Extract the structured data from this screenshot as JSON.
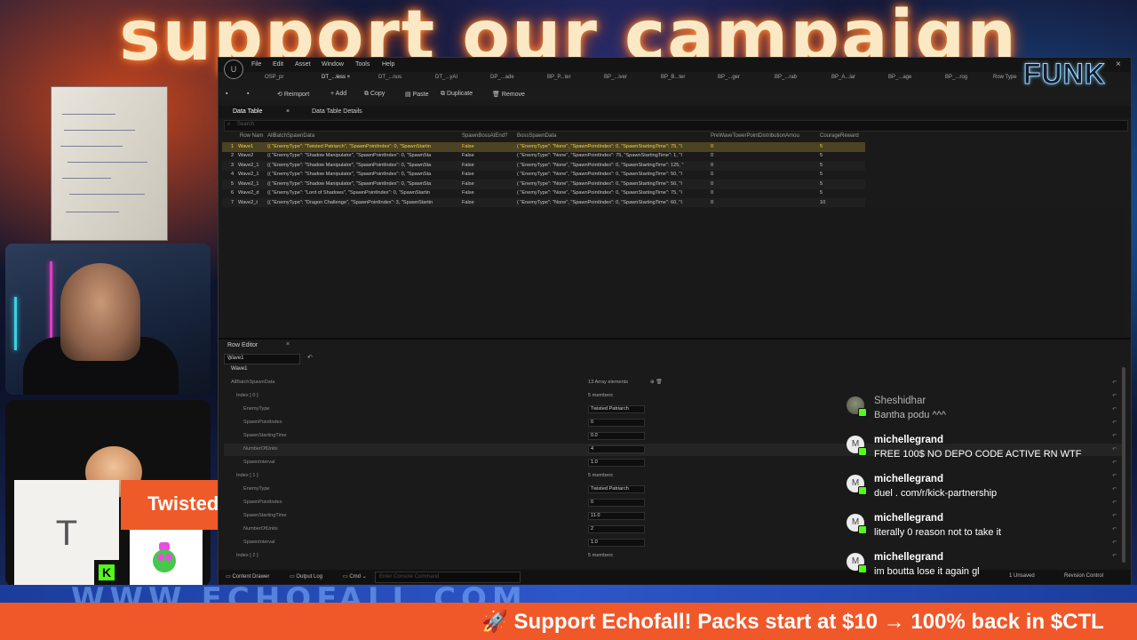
{
  "banner": {
    "headline": "support our campaign"
  },
  "streamer": {
    "name": "Twistedtinker",
    "initial": "T",
    "platform_badge": "K"
  },
  "editor": {
    "logo": "U",
    "menu": [
      "File",
      "Edit",
      "Asset",
      "Window",
      "Tools",
      "Help"
    ],
    "tabs": [
      "OSP_pr",
      "DT_...less ×",
      "DT_...nus",
      "DT_...yAI",
      "DP_...ade",
      "BP_P...ter",
      "BP_...iver",
      "BP_B...ter",
      "BP_...ger",
      "BP_...rab",
      "BP_A...lar",
      "BP_...age",
      "BP_...rog",
      "Row Type"
    ],
    "overlay_logo": "FUNK",
    "close": "×",
    "toolbar": {
      "reimport": "Reimport",
      "add": "Add",
      "copy": "Copy",
      "paste": "Paste",
      "duplicate": "Duplicate",
      "remove": "Remove"
    },
    "doc_tabs": {
      "data_table": "Data Table",
      "data_table_details": "Data Table Details"
    },
    "search_placeholder": "Search",
    "columns": [
      "Row Nam",
      "AllBatchSpawnData",
      "SpawnBossAtEnd?",
      "BossSpawnData",
      "PreWaveTowerPointDistributionAmou",
      "CourageReward"
    ],
    "rows": [
      {
        "num": "1",
        "name": "Wave1",
        "batch": "(( \"EnemyType\": \"Twisted Patriarch\", \"SpawnPointIndex\": 0, \"SpawnStartin",
        "boss": "False",
        "boss_data": "( \"EnemyType\": \"None\", \"SpawnPointIndex\": 0, \"SpawnStartingTime\": 75, \"I",
        "pre": "0",
        "courage": "5"
      },
      {
        "num": "2",
        "name": "Wave2",
        "batch": "(( \"EnemyType\": \"Shadow Manipulator\", \"SpawnPointIndex\": 0, \"SpawnSta",
        "boss": "False",
        "boss_data": "( \"EnemyType\": \"None\", \"SpawnPointIndex\": 75, \"SpawnStartingTime\": 1, \"I",
        "pre": "0",
        "courage": "5"
      },
      {
        "num": "3",
        "name": "Wave2_1",
        "batch": "(( \"EnemyType\": \"Shadow Manipulator\", \"SpawnPointIndex\": 0, \"SpawnSta",
        "boss": "False",
        "boss_data": "( \"EnemyType\": \"None\", \"SpawnPointIndex\": 0, \"SpawnStartingTime\": 125, \"",
        "pre": "0",
        "courage": "5"
      },
      {
        "num": "4",
        "name": "Wave2_1",
        "batch": "(( \"EnemyType\": \"Shadow Manipulator\", \"SpawnPointIndex\": 0, \"SpawnSta",
        "boss": "False",
        "boss_data": "( \"EnemyType\": \"None\", \"SpawnPointIndex\": 0, \"SpawnStartingTime\": 50, \"I",
        "pre": "0",
        "courage": "5"
      },
      {
        "num": "5",
        "name": "Wave2_1",
        "batch": "(( \"EnemyType\": \"Shadow Manipulator\", \"SpawnPointIndex\": 0, \"SpawnSta",
        "boss": "False",
        "boss_data": "( \"EnemyType\": \"None\", \"SpawnPointIndex\": 0, \"SpawnStartingTime\": 50, \"I",
        "pre": "0",
        "courage": "5"
      },
      {
        "num": "6",
        "name": "Wave2_d",
        "batch": "(( \"EnemyType\": \"Lord of Shadows\", \"SpawnPointIndex\": 0, \"SpawnStartin",
        "boss": "False",
        "boss_data": "( \"EnemyType\": \"None\", \"SpawnPointIndex\": 0, \"SpawnStartingTime\": 75, \"I",
        "pre": "0",
        "courage": "5"
      },
      {
        "num": "7",
        "name": "Wave2_t",
        "batch": "(( \"EnemyType\": \"Dragon Challenge\", \"SpawnPointIndex\": 3, \"SpawnStartin",
        "boss": "False",
        "boss_data": "( \"EnemyType\": \"None\", \"SpawnPointIndex\": 0, \"SpawnStartingTime\": 60, \"I",
        "pre": "0",
        "courage": "10"
      }
    ],
    "row_editor": {
      "tab": "Row Editor",
      "close": "×",
      "selected_row": "Wave1",
      "title": "Wave1",
      "props": [
        {
          "key": "AllBatchSpawnData",
          "value_text": "13 Array elements",
          "kind": "header"
        },
        {
          "key": "Index [ 0 ]",
          "value_text": "5 members",
          "kind": "sub"
        },
        {
          "key": "EnemyType",
          "value": "Twisted Patriarch",
          "kind": "field"
        },
        {
          "key": "SpawnPointIndex",
          "value": "0",
          "kind": "field"
        },
        {
          "key": "SpawnStartingTime",
          "value": "0.0",
          "kind": "field"
        },
        {
          "key": "NumberOfUnits",
          "value": "4",
          "kind": "field"
        },
        {
          "key": "SpawnInterval",
          "value": "1.0",
          "kind": "field"
        },
        {
          "key": "Index [ 1 ]",
          "value_text": "5 members",
          "kind": "sub"
        },
        {
          "key": "EnemyType",
          "value": "Twisted Patriarch",
          "kind": "field"
        },
        {
          "key": "SpawnPointIndex",
          "value": "0",
          "kind": "field"
        },
        {
          "key": "SpawnStartingTime",
          "value": "11.0",
          "kind": "field"
        },
        {
          "key": "NumberOfUnits",
          "value": "2",
          "kind": "field"
        },
        {
          "key": "SpawnInterval",
          "value": "1.0",
          "kind": "field"
        },
        {
          "key": "Index [ 2 ]",
          "value_text": "5 members",
          "kind": "sub"
        }
      ]
    },
    "status": {
      "content_drawer": "Content Drawer",
      "output_log": "Output Log",
      "cmd": "Cmd",
      "console_placeholder": "Enter Console Command",
      "unsaved": "1 Unsaved",
      "revision": "Revision Control"
    }
  },
  "chat": [
    {
      "user": "Sheshidhar",
      "text": "Bantha podu ^^^",
      "avatar": "",
      "dim": true
    },
    {
      "user": "michellegrand",
      "text": "FREE 100$ NO DEPO CODE ACTIVE RN WTF",
      "avatar": "M",
      "dim": false
    },
    {
      "user": "michellegrand",
      "text": "duel . com/r/kick-partnership",
      "avatar": "M",
      "dim": false
    },
    {
      "user": "michellegrand",
      "text": "literally 0 reason not to take it",
      "avatar": "M",
      "dim": false
    },
    {
      "user": "michellegrand",
      "text": "im boutta lose it again gl",
      "avatar": "M",
      "dim": false
    }
  ],
  "ticker": {
    "text": "🚀 Support Echofall! Packs start at $10 → 100% back in $CTL",
    "upper_text": "WWW.ECHOFALL.COM"
  },
  "colors": {
    "ticker_bg": "#f0582a",
    "name_tag_bg": "#ee5a28",
    "kick_green": "#53fc18",
    "selected_row": "#4b4322"
  }
}
